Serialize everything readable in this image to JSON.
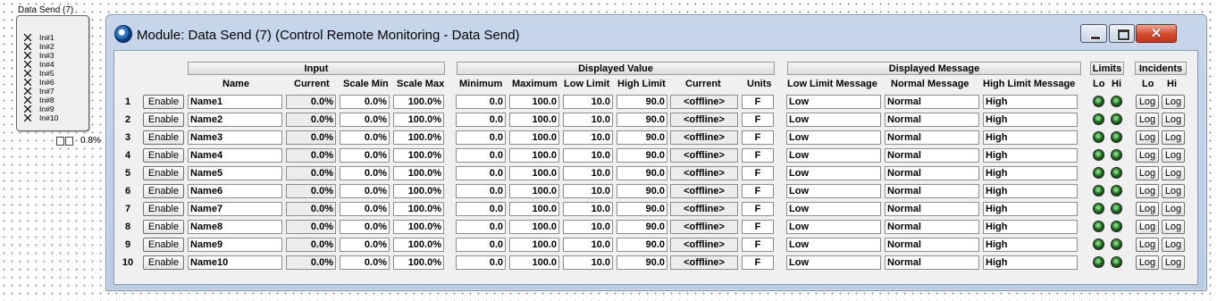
{
  "block": {
    "title": "Data Send (7)",
    "pins": [
      "In#1",
      "In#2",
      "In#3",
      "In#4",
      "In#5",
      "In#6",
      "In#7",
      "In#8",
      "In#9",
      "In#10"
    ],
    "percent": "0.8%"
  },
  "window": {
    "title": "Module: Data Send (7) (Control Remote Monitoring - Data Send)",
    "close_glyph": "✕"
  },
  "groups": {
    "input": "Input",
    "displayed_value": "Displayed Value",
    "displayed_message": "Displayed Message",
    "limits": "Limits",
    "incidents": "Incidents"
  },
  "columns": {
    "name": "Name",
    "current": "Current",
    "scale_min": "Scale Min",
    "scale_max": "Scale Max",
    "minimum": "Minimum",
    "maximum": "Maximum",
    "low_limit": "Low Limit",
    "high_limit": "High Limit",
    "dv_current": "Current",
    "units": "Units",
    "low_msg": "Low Limit Message",
    "normal_msg": "Normal Message",
    "high_msg": "High Limit Message",
    "limits_lo": "Lo",
    "limits_hi": "Hi",
    "inc_lo": "Lo",
    "inc_hi": "Hi"
  },
  "rows": [
    {
      "num": "1",
      "enable": "Enable",
      "name": "Name1",
      "current": "0.0%",
      "scale_min": "0.0%",
      "scale_max": "100.0%",
      "minimum": "0.0",
      "maximum": "100.0",
      "low_limit": "10.0",
      "high_limit": "90.0",
      "dv_current": "<offline>",
      "units": "F",
      "low_msg": "Low",
      "normal_msg": "Normal",
      "high_msg": "High",
      "log_lo": "Log",
      "log_hi": "Log"
    },
    {
      "num": "2",
      "enable": "Enable",
      "name": "Name2",
      "current": "0.0%",
      "scale_min": "0.0%",
      "scale_max": "100.0%",
      "minimum": "0.0",
      "maximum": "100.0",
      "low_limit": "10.0",
      "high_limit": "90.0",
      "dv_current": "<offline>",
      "units": "F",
      "low_msg": "Low",
      "normal_msg": "Normal",
      "high_msg": "High",
      "log_lo": "Log",
      "log_hi": "Log"
    },
    {
      "num": "3",
      "enable": "Enable",
      "name": "Name3",
      "current": "0.0%",
      "scale_min": "0.0%",
      "scale_max": "100.0%",
      "minimum": "0.0",
      "maximum": "100.0",
      "low_limit": "10.0",
      "high_limit": "90.0",
      "dv_current": "<offline>",
      "units": "F",
      "low_msg": "Low",
      "normal_msg": "Normal",
      "high_msg": "High",
      "log_lo": "Log",
      "log_hi": "Log"
    },
    {
      "num": "4",
      "enable": "Enable",
      "name": "Name4",
      "current": "0.0%",
      "scale_min": "0.0%",
      "scale_max": "100.0%",
      "minimum": "0.0",
      "maximum": "100.0",
      "low_limit": "10.0",
      "high_limit": "90.0",
      "dv_current": "<offline>",
      "units": "F",
      "low_msg": "Low",
      "normal_msg": "Normal",
      "high_msg": "High",
      "log_lo": "Log",
      "log_hi": "Log"
    },
    {
      "num": "5",
      "enable": "Enable",
      "name": "Name5",
      "current": "0.0%",
      "scale_min": "0.0%",
      "scale_max": "100.0%",
      "minimum": "0.0",
      "maximum": "100.0",
      "low_limit": "10.0",
      "high_limit": "90.0",
      "dv_current": "<offline>",
      "units": "F",
      "low_msg": "Low",
      "normal_msg": "Normal",
      "high_msg": "High",
      "log_lo": "Log",
      "log_hi": "Log"
    },
    {
      "num": "6",
      "enable": "Enable",
      "name": "Name6",
      "current": "0.0%",
      "scale_min": "0.0%",
      "scale_max": "100.0%",
      "minimum": "0.0",
      "maximum": "100.0",
      "low_limit": "10.0",
      "high_limit": "90.0",
      "dv_current": "<offline>",
      "units": "F",
      "low_msg": "Low",
      "normal_msg": "Normal",
      "high_msg": "High",
      "log_lo": "Log",
      "log_hi": "Log"
    },
    {
      "num": "7",
      "enable": "Enable",
      "name": "Name7",
      "current": "0.0%",
      "scale_min": "0.0%",
      "scale_max": "100.0%",
      "minimum": "0.0",
      "maximum": "100.0",
      "low_limit": "10.0",
      "high_limit": "90.0",
      "dv_current": "<offline>",
      "units": "F",
      "low_msg": "Low",
      "normal_msg": "Normal",
      "high_msg": "High",
      "log_lo": "Log",
      "log_hi": "Log"
    },
    {
      "num": "8",
      "enable": "Enable",
      "name": "Name8",
      "current": "0.0%",
      "scale_min": "0.0%",
      "scale_max": "100.0%",
      "minimum": "0.0",
      "maximum": "100.0",
      "low_limit": "10.0",
      "high_limit": "90.0",
      "dv_current": "<offline>",
      "units": "F",
      "low_msg": "Low",
      "normal_msg": "Normal",
      "high_msg": "High",
      "log_lo": "Log",
      "log_hi": "Log"
    },
    {
      "num": "9",
      "enable": "Enable",
      "name": "Name9",
      "current": "0.0%",
      "scale_min": "0.0%",
      "scale_max": "100.0%",
      "minimum": "0.0",
      "maximum": "100.0",
      "low_limit": "10.0",
      "high_limit": "90.0",
      "dv_current": "<offline>",
      "units": "F",
      "low_msg": "Low",
      "normal_msg": "Normal",
      "high_msg": "High",
      "log_lo": "Log",
      "log_hi": "Log"
    },
    {
      "num": "10",
      "enable": "Enable",
      "name": "Name10",
      "current": "0.0%",
      "scale_min": "0.0%",
      "scale_max": "100.0%",
      "minimum": "0.0",
      "maximum": "100.0",
      "low_limit": "10.0",
      "high_limit": "90.0",
      "dv_current": "<offline>",
      "units": "F",
      "low_msg": "Low",
      "normal_msg": "Normal",
      "high_msg": "High",
      "log_lo": "Log",
      "log_hi": "Log"
    }
  ]
}
